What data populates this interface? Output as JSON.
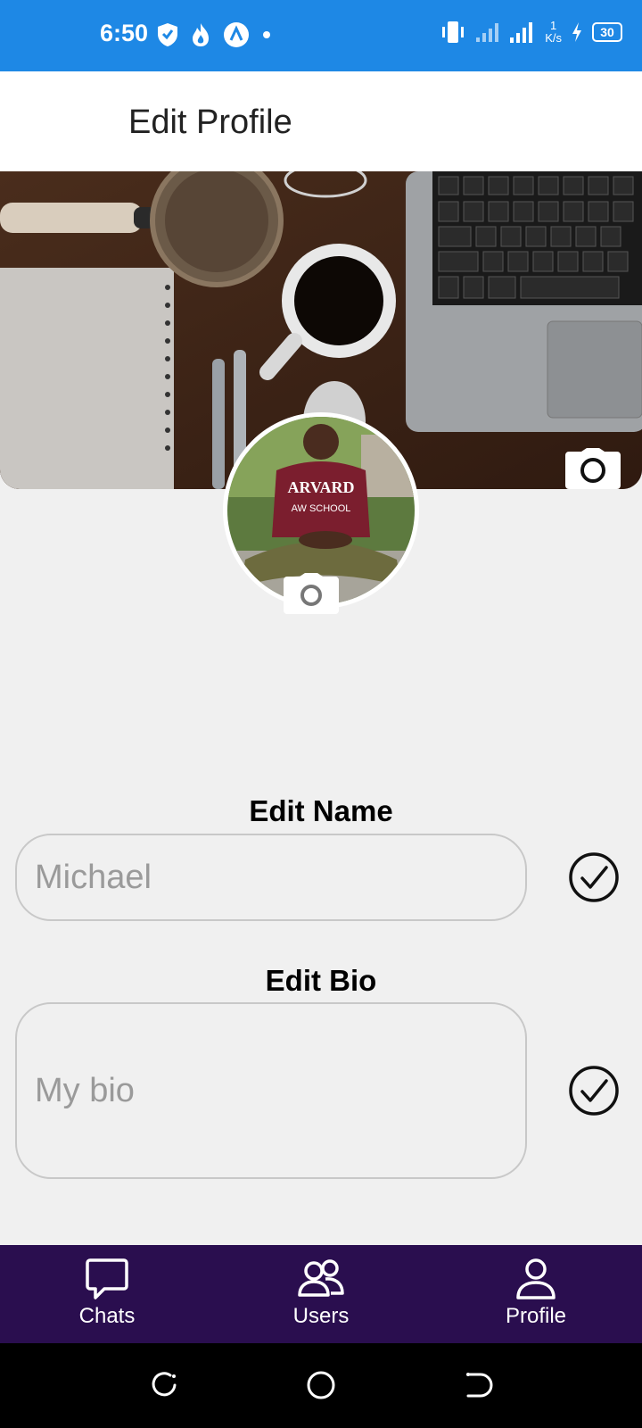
{
  "status_bar": {
    "time": "6:50",
    "net_speed_value": "1",
    "net_speed_unit": "K/s",
    "battery": "30",
    "icons": [
      "shield-icon",
      "flame-icon",
      "app-a-icon",
      "dot-icon",
      "vibrate-icon",
      "signal-icon",
      "signal-5g-icon",
      "charging-icon",
      "battery-icon"
    ]
  },
  "header": {
    "title": "Edit Profile"
  },
  "profile": {
    "cover_camera_icon": "camera-icon",
    "avatar_camera_icon": "camera-icon"
  },
  "form": {
    "name_label": "Edit Name",
    "name_value": "Michael",
    "bio_label": "Edit Bio",
    "bio_value": "My bio",
    "confirm_icon": "check-circle-icon"
  },
  "bottom_nav": {
    "items": [
      {
        "label": "Chats",
        "icon": "chat-bubble-icon"
      },
      {
        "label": "Users",
        "icon": "users-icon"
      },
      {
        "label": "Profile",
        "icon": "person-icon"
      }
    ]
  },
  "colors": {
    "status_bar": "#1e88e5",
    "app_bar": "#ffffff",
    "background": "#f0f0f0",
    "bottom_nav": "#2a0e4f",
    "system_nav": "#000000"
  }
}
